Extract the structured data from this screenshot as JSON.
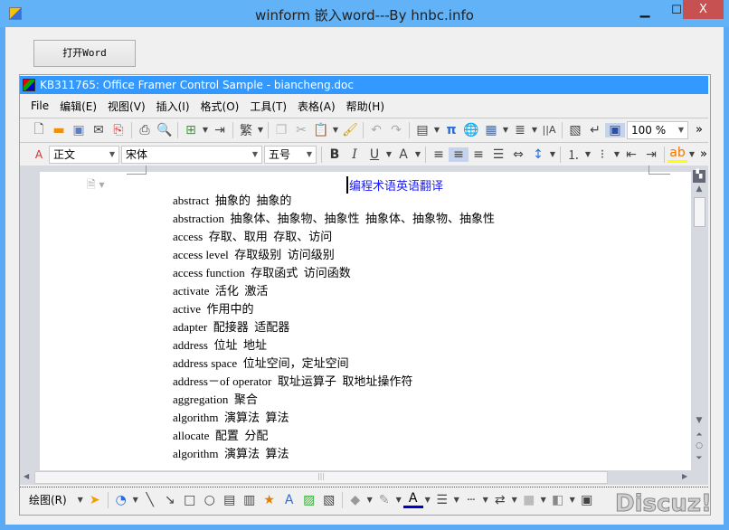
{
  "window": {
    "title": "winform 嵌入word---By hnbc.info",
    "minimize": "▁",
    "maximize": "☐",
    "close": "X"
  },
  "open_button": "打开Word",
  "framer": {
    "title": "KB311765: Office Framer Control Sample - biancheng.doc",
    "menu": [
      "File",
      "编辑(E)",
      "视图(V)",
      "插入(I)",
      "格式(O)",
      "工具(T)",
      "表格(A)",
      "帮助(H)"
    ],
    "toolbar1_icons": [
      "new-document-icon",
      "open-icon",
      "save-icon",
      "email-icon",
      "export-pdf-icon",
      "print-icon",
      "print-preview-icon",
      "insert-page-icon",
      "page-break-icon",
      "traditional-chinese-icon",
      "copy-icon",
      "cut-icon",
      "paste-icon",
      "format-painter-icon",
      "undo-icon",
      "redo-icon",
      "table-icon",
      "pi-icon",
      "hyperlink-icon",
      "grid-table-icon",
      "columns-icon",
      "text-direction-icon",
      "document-map-icon",
      "paragraph-mark-icon",
      "page-view-icon"
    ],
    "zoom": "100 %",
    "style": "正文",
    "font": "宋体",
    "size": "五号",
    "bold": "B",
    "italic": "I",
    "underline": "U",
    "chevron": "»",
    "alignment_active": "center"
  },
  "document": {
    "title": "编程术语英语翻译",
    "lines": [
      "abstract  抽象的  抽象的",
      "abstraction  抽象体、抽象物、抽象性  抽象体、抽象物、抽象性",
      "access  存取、取用  存取、访问",
      "access level  存取级别  访问级别",
      "access function  存取函式  访问函数",
      "activate  活化  激活",
      "active  作用中的",
      "adapter  配接器  适配器",
      "address  位址  地址",
      "address space  位址空间，定址空间",
      "address－of operator  取址运算子  取地址操作符",
      "aggregation  聚合",
      "algorithm  演算法  算法",
      "allocate  配置  分配",
      "algorithm  演算法  算法"
    ]
  },
  "drawing_toolbar": {
    "label": "绘图(R)"
  },
  "watermark": "Discuz!"
}
